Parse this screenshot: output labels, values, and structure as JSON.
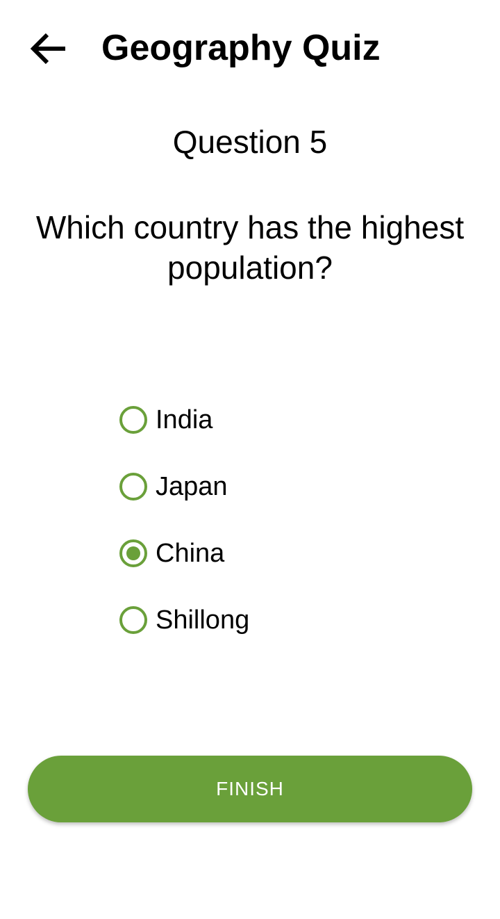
{
  "toolbar": {
    "back_icon": "arrow-back-icon",
    "title": "Geography Quiz"
  },
  "question": {
    "number_label": "Question 5",
    "text": "Which country has the highest population?"
  },
  "options": [
    {
      "label": "India",
      "selected": false
    },
    {
      "label": "Japan",
      "selected": false
    },
    {
      "label": "China",
      "selected": true
    },
    {
      "label": "Shillong",
      "selected": false
    }
  ],
  "finish_button": {
    "label": "FINISH"
  },
  "colors": {
    "accent": "#6aa03a",
    "background": "#ffffff",
    "text": "#000000",
    "button_text": "#ffffff"
  }
}
